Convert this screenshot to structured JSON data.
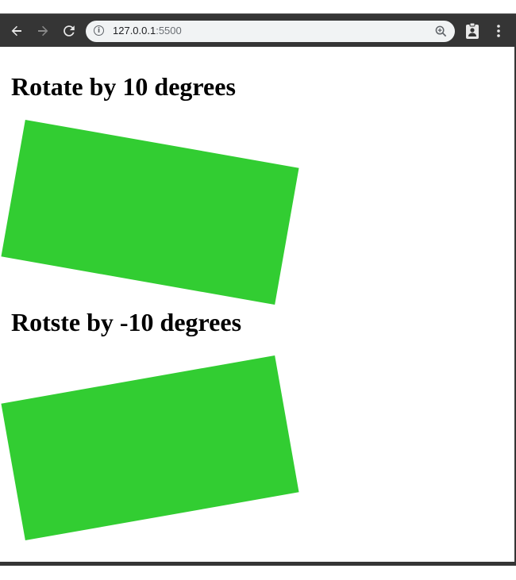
{
  "browser": {
    "url_host": "127.0.0.1",
    "url_port": ":5500",
    "icons": {
      "back": "arrow-left-icon",
      "forward": "arrow-right-icon",
      "reload": "reload-icon",
      "site_info": "info-icon",
      "zoom": "zoom-icon",
      "extension": "extension-icon",
      "menu": "more-vertical-icon"
    }
  },
  "page": {
    "heading_rotate": "Rotate by 10 degrees",
    "heading_rotate_negative": "Rotste by -10 degrees",
    "rotation_1_deg": 10,
    "rotation_2_deg": -10,
    "box_color": "#32cd32"
  }
}
